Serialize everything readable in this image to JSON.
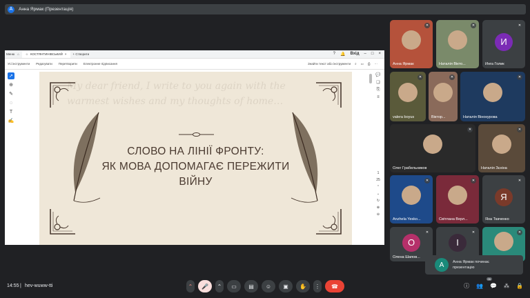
{
  "topbar": {
    "avatar_letter": "A",
    "title": "Анна Ярмак (Презентація)"
  },
  "browser": {
    "menu_label": "Меню",
    "tab_label": "КОСТЯНТИНІВСЬКИЙ",
    "new_tab_label": "+ Створити",
    "right_label": "Вхід",
    "toolbar": [
      "Усі інструменти",
      "Редагувати",
      "Перетворити",
      "Електронне підписання"
    ],
    "search_label": "Знайти текст або інструменти"
  },
  "slide": {
    "title_line1": "СЛОВО НА ЛІНІЇ ФРОНТУ:",
    "title_line2": "ЯК МОВА ДОПОМАГАЄ ПЕРЕЖИТИ",
    "title_line3": "ВІЙНУ",
    "bg_script": "My dear friend, I write to you again with the warmest wishes and my thoughts of home…",
    "page_current": "1",
    "page_total": "25"
  },
  "participants": [
    {
      "name": "Анна Ярмак",
      "color": "#b5523b",
      "type": "face"
    },
    {
      "name": "Наталія Вікто...",
      "color": "#7a8a6a",
      "type": "face"
    },
    {
      "name": "Инга Голик",
      "color": "#7b2bb5",
      "type": "letter",
      "letter": "И"
    },
    {
      "name": "valera boyus",
      "color": "#5a5a3a",
      "type": "face"
    },
    {
      "name": "Віктор...",
      "color": "#8a6a5a",
      "type": "face"
    },
    {
      "name": "Наталія Вінокурова",
      "color": "#1e3a5f",
      "type": "face"
    },
    {
      "name": "Олег Грабельников",
      "color": "#2a2a2a",
      "type": "face"
    },
    {
      "name": "Наталія Зєніна",
      "color": "#5a4a3a",
      "type": "face"
    },
    {
      "name": "Anzhela Yesko...",
      "color": "#1e4a8a",
      "type": "face"
    },
    {
      "name": "Світлана Верл...",
      "color": "#7a2a3a",
      "type": "face"
    },
    {
      "name": "Яна Ткаченко",
      "color": "#7a3a2a",
      "type": "letter",
      "letter": "Я"
    },
    {
      "name": "Олена Шапов...",
      "color": "#b5306a",
      "type": "letter",
      "letter": "О"
    },
    {
      "name": "",
      "color": "#3a2a3a",
      "type": "letter",
      "letter": "І"
    },
    {
      "name": "",
      "color": "#2a8a7a",
      "type": "face"
    }
  ],
  "notice": {
    "avatar_letter": "А",
    "line1": "Анна Ярмак починає",
    "line2": "презентацію"
  },
  "bottom": {
    "time": "14:55",
    "separator": "|",
    "code": "hev-wuww-tti",
    "participant_count": "26"
  },
  "colors": {
    "accent": "#1a73e8",
    "end_call": "#ea4335"
  }
}
